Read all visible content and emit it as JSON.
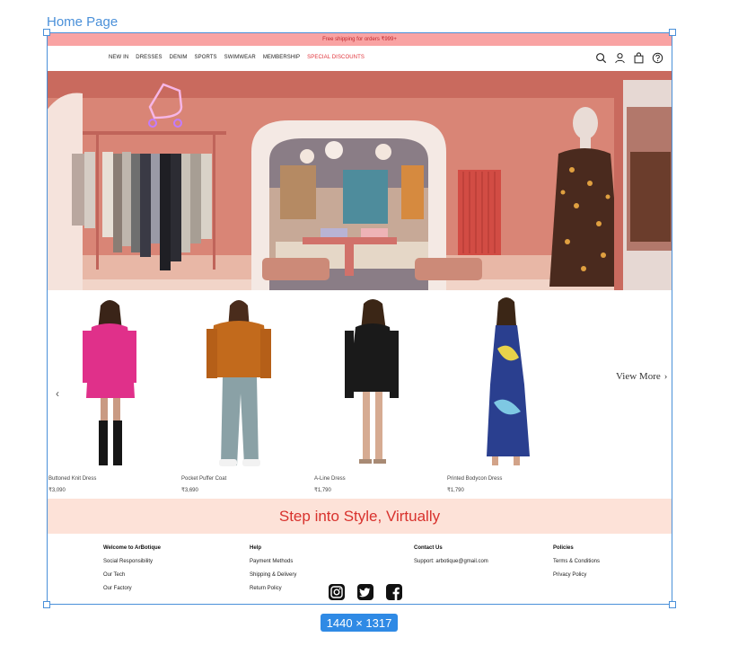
{
  "frame": {
    "label": "Home Page",
    "size_badge": "1440 × 1317"
  },
  "announcement": "Free shipping for orders ₹999+",
  "nav": {
    "links": [
      "NEW IN",
      "DRESSES",
      "DENIM",
      "SPORTS",
      "SWIMWEAR",
      "MEMBERSHIP"
    ],
    "special": "SPECIAL DISCOUNTS",
    "icons": [
      "search-icon",
      "user-icon",
      "bag-icon",
      "help-icon"
    ]
  },
  "hero": {
    "description_icon": "boutique-interior-image"
  },
  "products": {
    "view_more": "View More",
    "items": [
      {
        "name": "Buttoned Knit Dress",
        "price": "₹3,090",
        "color": "#e0308a"
      },
      {
        "name": "Pocket Puffer Coat",
        "price": "₹3,690",
        "color": "#c26a1c"
      },
      {
        "name": "A-Line Dress",
        "price": "₹1,790",
        "color": "#1a1a1a"
      },
      {
        "name": "Printed Bodycon Dress",
        "price": "₹1,790",
        "color": "#2a3f8f"
      }
    ]
  },
  "promo": "Step into Style, Virtually",
  "footer": {
    "col1": {
      "heading": "Welcome to ArBotique",
      "links": [
        "Social Responsibility",
        "Our Tech",
        "Our Factory"
      ]
    },
    "col2": {
      "heading": "Help",
      "links": [
        "Payment Methods",
        "Shipping & Delivery",
        "Return Policy"
      ]
    },
    "col3": {
      "heading": "Contact Us",
      "links": [
        "Support: arbotique@gmail.com"
      ]
    },
    "col4": {
      "heading": "Policies",
      "links": [
        "Terms & Conditions",
        "Privacy Policy"
      ]
    },
    "socials": [
      "instagram-icon",
      "twitter-icon",
      "facebook-icon"
    ]
  },
  "colors": {
    "announcement_bg": "#f9a3a3",
    "accent_red": "#d8322d",
    "promo_bg": "#fde2d8",
    "selection_blue": "#4a90d9"
  }
}
